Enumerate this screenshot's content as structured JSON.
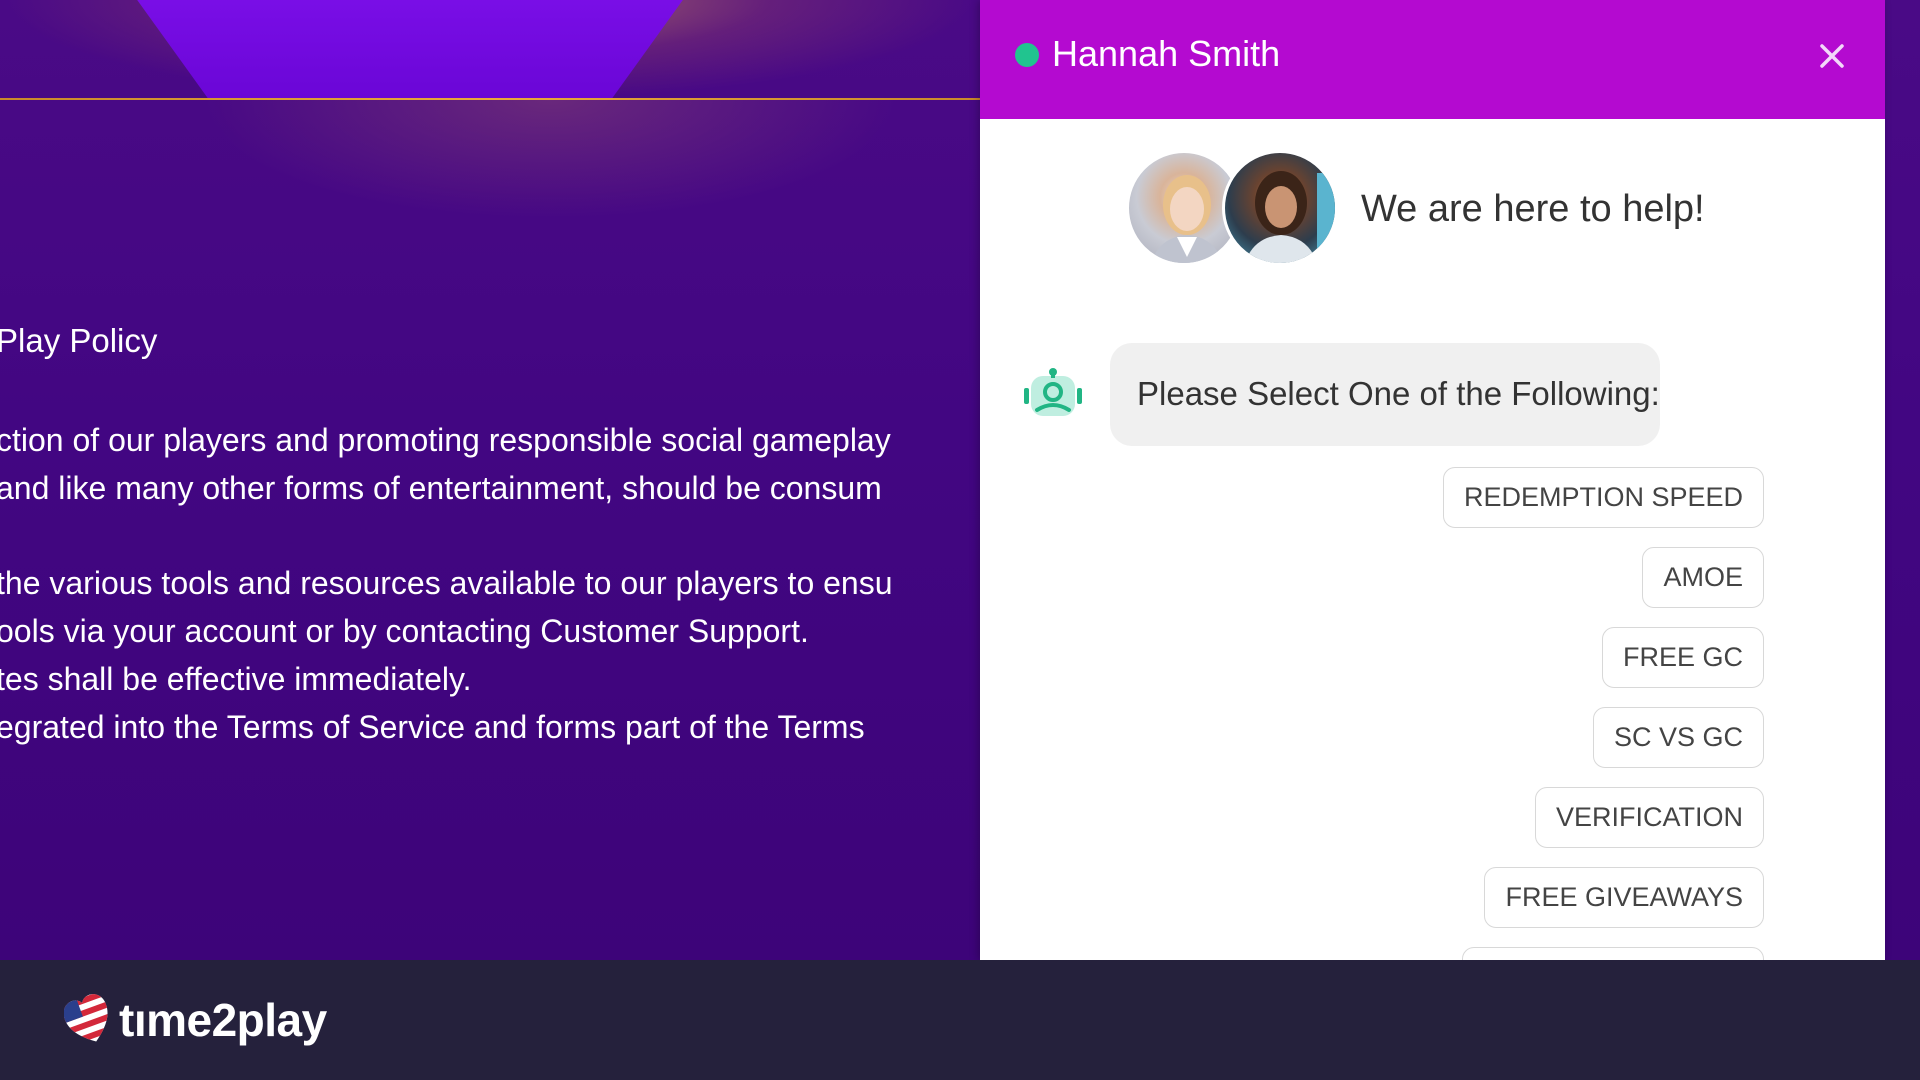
{
  "page": {
    "title": "Play Policy",
    "lines": [
      "ction of our players and promoting responsible social gameplay",
      "and like many other forms of entertainment, should be consum",
      "the various tools and resources available to our players to ensu",
      "ools via your account or by contacting Customer Support.",
      "tes shall be effective immediately.",
      "egrated into the Terms of Service and forms part of the Terms"
    ]
  },
  "chat": {
    "agent_name": "Hannah Smith",
    "status_color": "#21c48f",
    "header_color": "#b40ad0",
    "close_icon": "close-icon",
    "intro_text": "We are here to help!",
    "bot_message": "Please Select One of the Following:",
    "options": [
      "REDEMPTION SPEED",
      "AMOE",
      "FREE GC",
      "SC VS GC",
      "VERIFICATION",
      "FREE GIVEAWAYS"
    ]
  },
  "footer": {
    "brand": "tıme2play",
    "flag_icon": "us-flag-icon"
  }
}
